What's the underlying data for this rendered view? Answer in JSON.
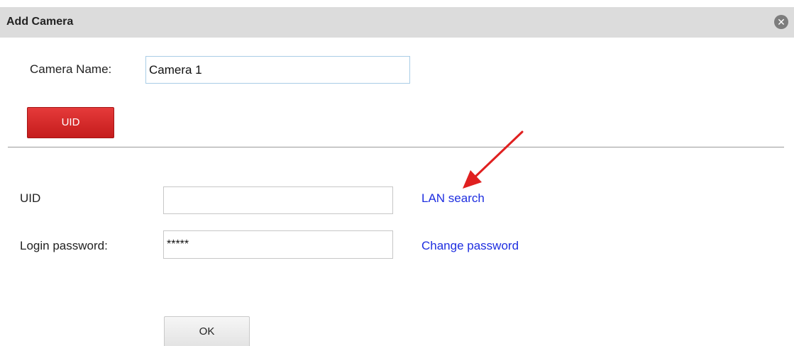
{
  "dialog": {
    "title": "Add Camera",
    "close_symbol": "✕"
  },
  "camera_name": {
    "label": "Camera Name:",
    "value": "Camera 1"
  },
  "mode_button": {
    "label": "UID",
    "color": "#d42a2a"
  },
  "uid_field": {
    "label": "UID",
    "value": ""
  },
  "password_field": {
    "label": "Login password:",
    "value": "*****"
  },
  "links": {
    "lan_search": "LAN search",
    "change_password": "Change password",
    "color": "#1e2ee0"
  },
  "ok_button": {
    "label": "OK"
  },
  "annotation": {
    "arrow_color": "#e02020"
  }
}
